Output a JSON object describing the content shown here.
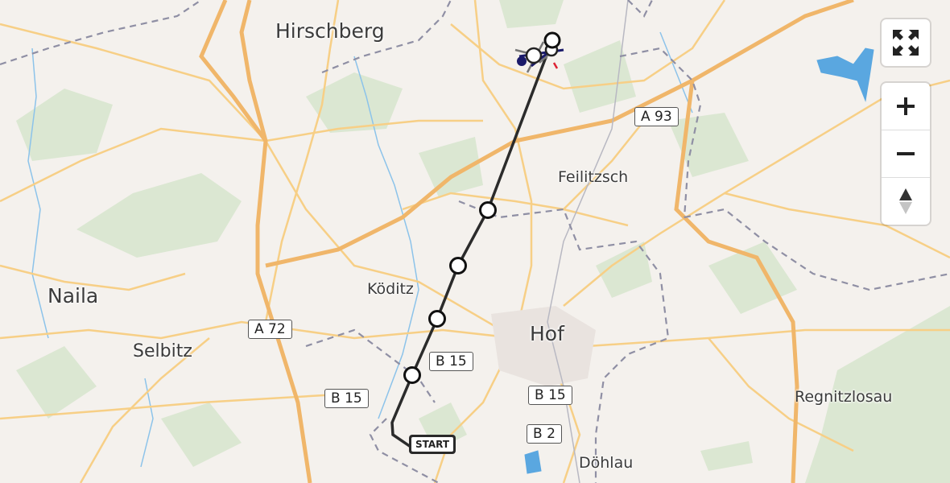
{
  "map": {
    "places": [
      {
        "id": "hirschberg",
        "name": "Hirschberg",
        "size": "big"
      },
      {
        "id": "feilitzsch",
        "name": "Feilitzsch",
        "size": "sm"
      },
      {
        "id": "naila",
        "name": "Naila",
        "size": "big"
      },
      {
        "id": "koditz",
        "name": "Köditz",
        "size": "sm"
      },
      {
        "id": "selbitz",
        "name": "Selbitz",
        "size": "mid"
      },
      {
        "id": "hof",
        "name": "Hof",
        "size": "big"
      },
      {
        "id": "regnitzlosau",
        "name": "Regnitzlosau",
        "size": "sm"
      },
      {
        "id": "dohlau",
        "name": "Döhlau",
        "size": "sm"
      }
    ],
    "road_shields": [
      {
        "id": "a93",
        "label": "A 93"
      },
      {
        "id": "a72",
        "label": "A 72"
      },
      {
        "id": "b15-1",
        "label": "B 15"
      },
      {
        "id": "b15-2",
        "label": "B 15"
      },
      {
        "id": "b15-3",
        "label": "B 15"
      },
      {
        "id": "b2",
        "label": "B 2"
      }
    ],
    "route": {
      "start_label": "START",
      "waypoint_count": 5
    },
    "colors": {
      "background": "#f4f1ed",
      "forest": "#dbe7d2",
      "motorway": "#f0b66a",
      "road": "#f7cf86",
      "border": "#8f8fa4",
      "water": "#5aa7e0",
      "route": "#2b2b2b"
    }
  },
  "controls": {
    "fullscreen_icon": "expand-arrows-icon",
    "zoom_in_icon": "plus-icon",
    "zoom_out_icon": "minus-icon",
    "compass_icon": "compass-north-icon"
  }
}
